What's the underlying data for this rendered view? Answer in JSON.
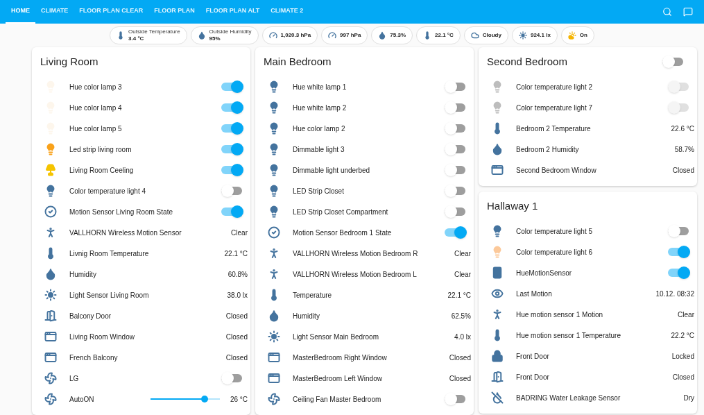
{
  "tabs": [
    {
      "label": "HOME",
      "selected": true
    },
    {
      "label": "CLIMATE",
      "selected": false
    },
    {
      "label": "FLOOR PLAN CLEAR",
      "selected": false
    },
    {
      "label": "FLOOR PLAN",
      "selected": false
    },
    {
      "label": "FLOOR PLAN ALT",
      "selected": false
    },
    {
      "label": "CLIMATE 2",
      "selected": false
    }
  ],
  "badges": [
    {
      "kind": "thermometer",
      "label": "Outside Temperature",
      "value": "3.4 °C"
    },
    {
      "kind": "water",
      "label": "Outside Humidity",
      "value": "95%"
    },
    {
      "kind": "gauge",
      "value": "1,020.3 hPa"
    },
    {
      "kind": "gauge",
      "value": "997 hPa"
    },
    {
      "kind": "water",
      "value": "75.3%"
    },
    {
      "kind": "thermometer",
      "value": "22.1 °C"
    },
    {
      "kind": "cloud",
      "value": "Cloudy"
    },
    {
      "kind": "sun",
      "value": "924.1 lx"
    },
    {
      "kind": "weather",
      "value": "On"
    }
  ],
  "columns": [
    [
      {
        "title": "Living Room",
        "rows": [
          {
            "kind": "bulb",
            "color": "#fdf6ec",
            "name": "Hue color lamp 3",
            "on": true,
            "disabled": false
          },
          {
            "kind": "bulb",
            "color": "#fdf6ec",
            "name": "Hue color lamp 4",
            "on": true,
            "disabled": false
          },
          {
            "kind": "bulb",
            "color": "#fdf6ec",
            "name": "Hue color lamp 5",
            "on": true,
            "disabled": false
          },
          {
            "kind": "bulb",
            "color": "#f9a21b",
            "name": "Led strip living room",
            "on": true,
            "disabled": false
          },
          {
            "kind": "ceiling",
            "color": "#f5c400",
            "name": "Living Room Ceeling",
            "on": true,
            "disabled": false
          },
          {
            "kind": "bulb",
            "color": "#44739e",
            "name": "Color temperature light 4",
            "on": false,
            "disabled": false
          },
          {
            "kind": "check",
            "color": "#44739e",
            "name": "Motion Sensor Living Room State",
            "on": true,
            "disabled": false
          },
          {
            "kind": "motion",
            "color": "#44739e",
            "name": "VALLHORN Wireless Motion Sensor",
            "value": "Clear"
          },
          {
            "kind": "thermometer",
            "color": "#44739e",
            "name": "Livnig Room Temperature",
            "value": "22.1 °C"
          },
          {
            "kind": "water",
            "color": "#44739e",
            "name": "Humidity",
            "value": "60.8%"
          },
          {
            "kind": "sun",
            "color": "#44739e",
            "name": "Light Sensor Living Room",
            "value": "38.0 lx"
          },
          {
            "kind": "door",
            "color": "#44739e",
            "name": "Balcony Door",
            "value": "Closed"
          },
          {
            "kind": "window",
            "color": "#44739e",
            "name": "Living Room Window",
            "value": "Closed"
          },
          {
            "kind": "window",
            "color": "#44739e",
            "name": "French Balcony",
            "value": "Closed"
          },
          {
            "kind": "ac",
            "color": "#44739e",
            "name": "LG",
            "on": false,
            "disabled": false
          },
          {
            "kind": "ac",
            "color": "#44739e",
            "name": "AutoON",
            "level": 0.78,
            "value": "26 °C"
          }
        ]
      }
    ],
    [
      {
        "title": "Main Bedroom",
        "rows": [
          {
            "kind": "bulb",
            "color": "#44739e",
            "name": "Hue white lamp 1",
            "on": false,
            "disabled": false
          },
          {
            "kind": "bulb",
            "color": "#44739e",
            "name": "Hue white lamp 2",
            "on": false,
            "disabled": false
          },
          {
            "kind": "bulb",
            "color": "#44739e",
            "name": "Hue color lamp 2",
            "on": false,
            "disabled": false
          },
          {
            "kind": "bulb",
            "color": "#44739e",
            "name": "Dimmable light 3",
            "on": false,
            "disabled": false
          },
          {
            "kind": "bulb",
            "color": "#44739e",
            "name": "Dimmable light underbed",
            "on": false,
            "disabled": false
          },
          {
            "kind": "bulb",
            "color": "#44739e",
            "name": "LED Strip Closet",
            "on": false,
            "disabled": false
          },
          {
            "kind": "bulb",
            "color": "#44739e",
            "name": "LED Strip Closet Compartment",
            "on": false,
            "disabled": false
          },
          {
            "kind": "check",
            "color": "#44739e",
            "name": "Motion Sensor Bedroom 1 State",
            "on": true,
            "disabled": false
          },
          {
            "kind": "motion",
            "color": "#44739e",
            "name": "VALLHORN Wireless Motion Bedroom R",
            "value": "Clear"
          },
          {
            "kind": "motion",
            "color": "#44739e",
            "name": "VALLHORN Wireless Motion Bedroom L",
            "value": "Clear"
          },
          {
            "kind": "thermometer",
            "color": "#44739e",
            "name": "Temperature",
            "value": "22.1 °C"
          },
          {
            "kind": "water",
            "color": "#44739e",
            "name": "Humidity",
            "value": "62.5%"
          },
          {
            "kind": "sun",
            "color": "#44739e",
            "name": "Light Sensor Main Bedroom",
            "value": "4.0 lx"
          },
          {
            "kind": "window",
            "color": "#44739e",
            "name": "MasterBedroom Right Window",
            "value": "Closed"
          },
          {
            "kind": "window",
            "color": "#44739e",
            "name": "MasterBedroom Left Window",
            "value": "Closed"
          },
          {
            "kind": "fan",
            "color": "#44739e",
            "name": "Ceiling Fan Master Bedroom",
            "on": false,
            "disabled": false
          }
        ]
      }
    ],
    [
      {
        "title": "Second Bedroom",
        "toggle": {
          "on": false
        },
        "rows": [
          {
            "kind": "bulb",
            "color": "#bdbdbd",
            "name": "Color temperature light 2",
            "on": false,
            "disabled": true
          },
          {
            "kind": "bulb",
            "color": "#bdbdbd",
            "name": "Color temperature light 7",
            "on": false,
            "disabled": true
          },
          {
            "kind": "thermometer",
            "color": "#44739e",
            "name": "Bedroom 2 Temperature",
            "value": "22.6 °C"
          },
          {
            "kind": "water",
            "color": "#44739e",
            "name": "Bedroom 2 Humidity",
            "value": "58.7%"
          },
          {
            "kind": "window",
            "color": "#44739e",
            "name": "Second Bedroom Window",
            "value": "Closed"
          }
        ]
      },
      {
        "title": "Hallaway 1",
        "rows": [
          {
            "kind": "bulb",
            "color": "#44739e",
            "name": "Color temperature light 5",
            "on": false,
            "disabled": false
          },
          {
            "kind": "bulb",
            "color": "#fcc99a",
            "name": "Color temperature light 6",
            "on": true,
            "disabled": false
          },
          {
            "kind": "sensor",
            "color": "#44739e",
            "name": "HueMotionSensor",
            "on": true,
            "disabled": false
          },
          {
            "kind": "eye",
            "color": "#44739e",
            "name": "Last Motion",
            "value": "10.12. 08:32"
          },
          {
            "kind": "motion",
            "color": "#44739e",
            "name": "Hue motion sensor 1 Motion",
            "value": "Clear"
          },
          {
            "kind": "thermometer",
            "color": "#44739e",
            "name": "Hue motion sensor 1 Temperature",
            "value": "22.2 °C"
          },
          {
            "kind": "lock",
            "color": "#44739e",
            "name": "Front Door",
            "value": "Locked"
          },
          {
            "kind": "door",
            "color": "#44739e",
            "name": "Front Door",
            "value": "Closed"
          },
          {
            "kind": "leak",
            "color": "#44739e",
            "name": "BADRING Water Leakage Sensor",
            "value": "Dry"
          }
        ]
      }
    ]
  ]
}
